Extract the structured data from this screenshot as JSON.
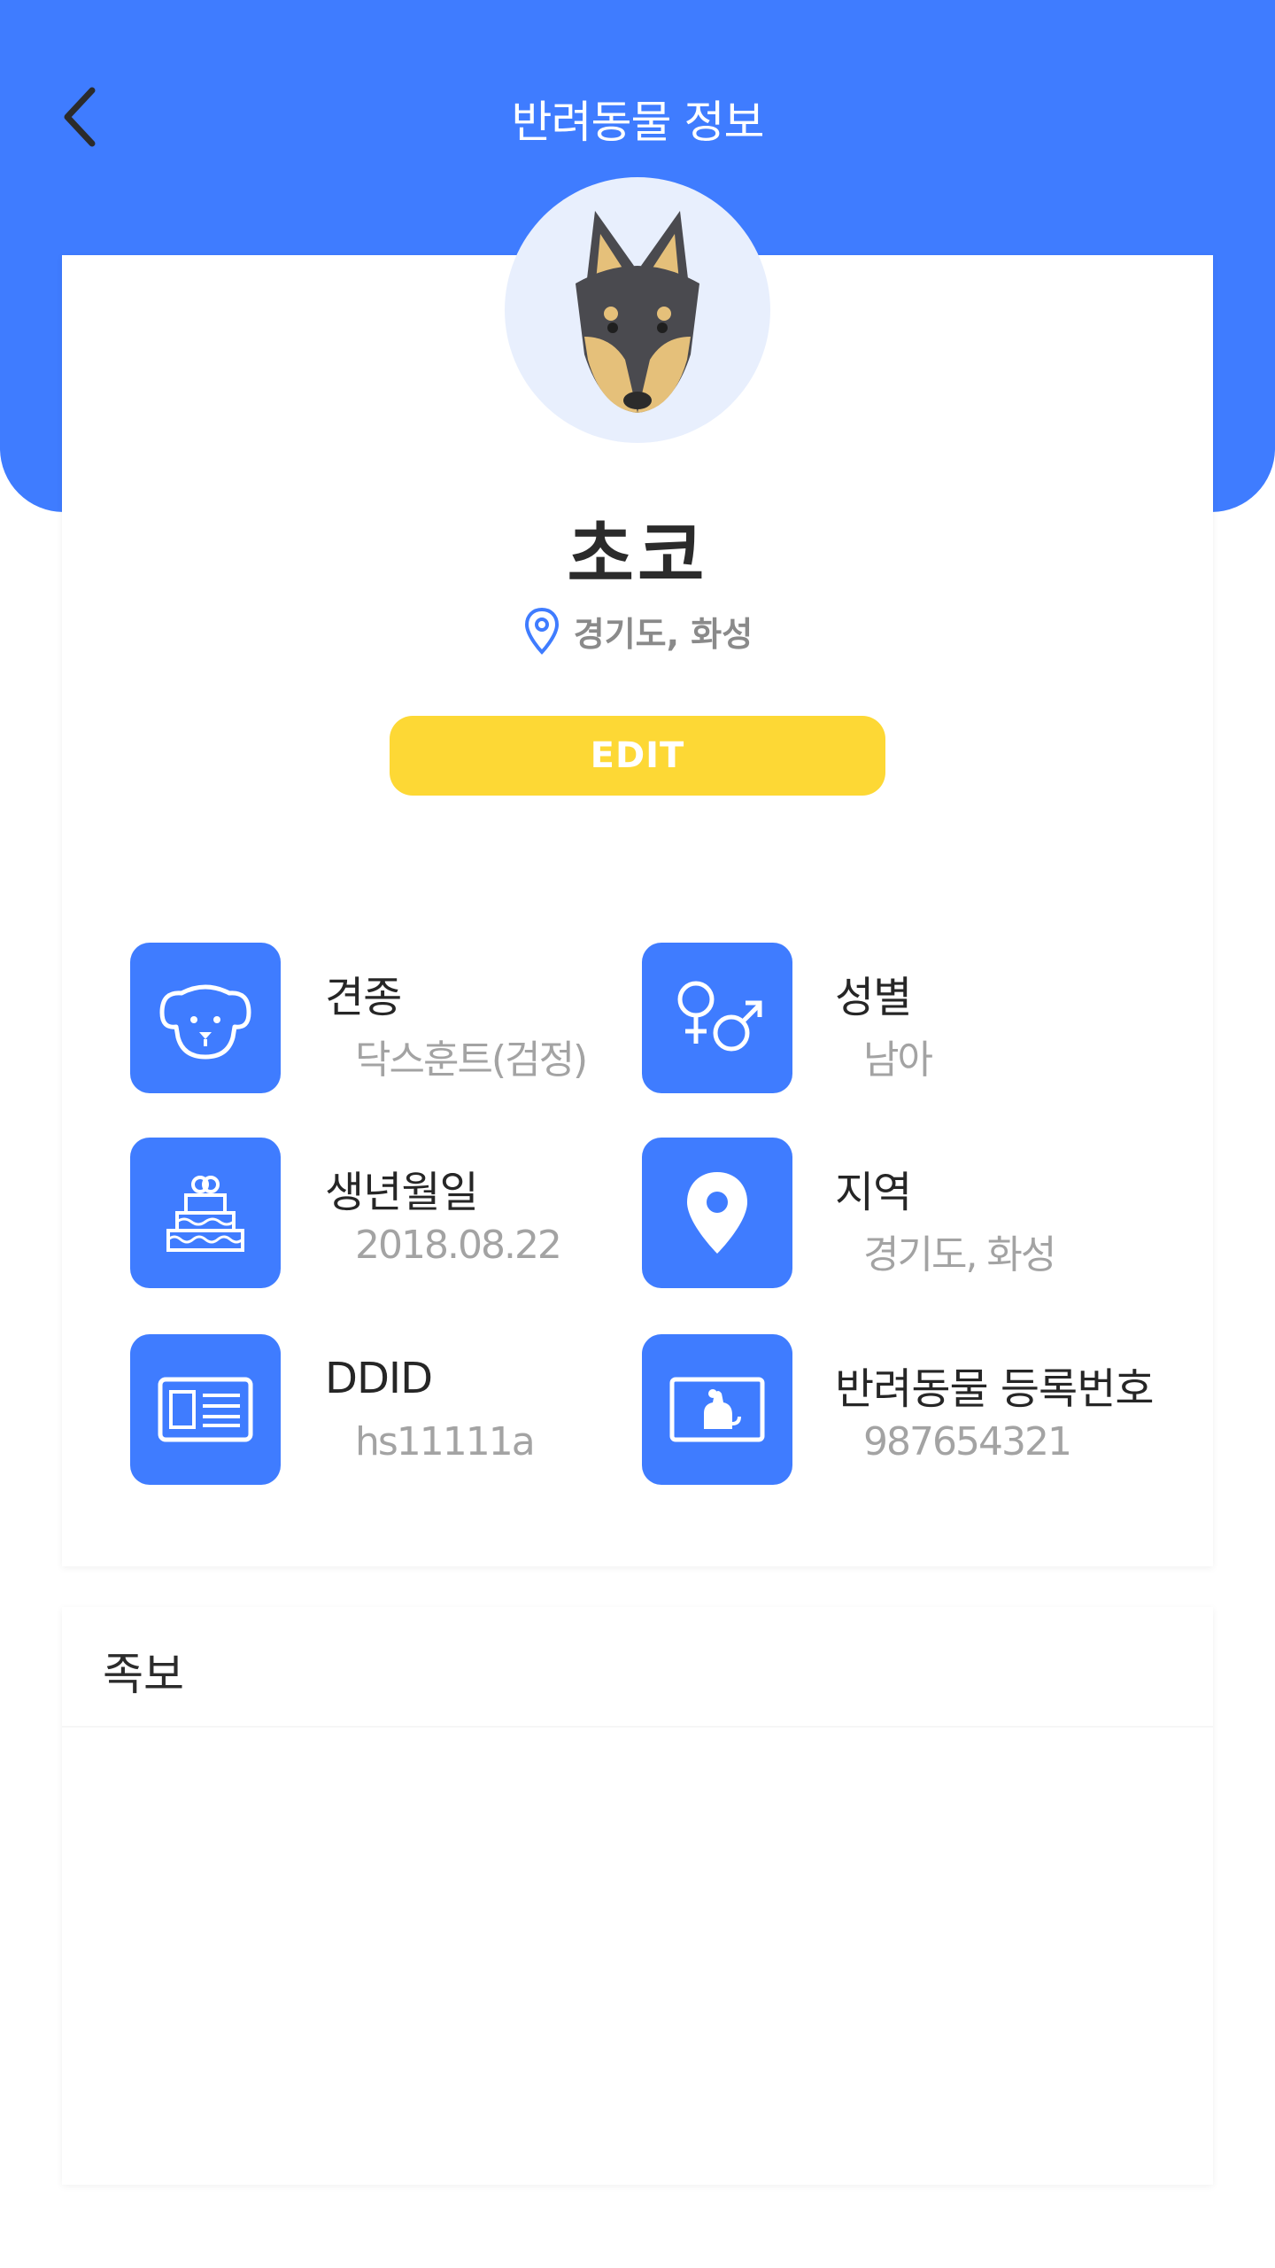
{
  "header": {
    "title": "반려동물 정보",
    "back_icon": "chevron-left-icon",
    "background_color": "#3f7cff"
  },
  "profile": {
    "avatar_icon": "dog-head-icon",
    "name": "초코",
    "location": "경기도, 화성",
    "location_icon": "map-pin-icon",
    "edit_label": "EDIT",
    "edit_color": "#fdd835"
  },
  "info": [
    {
      "icon": "dog-face-icon",
      "label": "견종",
      "value": "닥스훈트(검정)"
    },
    {
      "icon": "gender-icon",
      "label": "성별",
      "value": "남아"
    },
    {
      "icon": "birthday-cake-icon",
      "label": "생년월일",
      "value": "2018.08.22"
    },
    {
      "icon": "location-pin-icon",
      "label": "지역",
      "value": "경기도, 화성"
    },
    {
      "icon": "id-card-icon",
      "label": "DDID",
      "value": "hs11111a"
    },
    {
      "icon": "pet-registration-card-icon",
      "label": "반려동물 등록번호",
      "value": "987654321"
    }
  ],
  "pedigree": {
    "title": "족보"
  }
}
